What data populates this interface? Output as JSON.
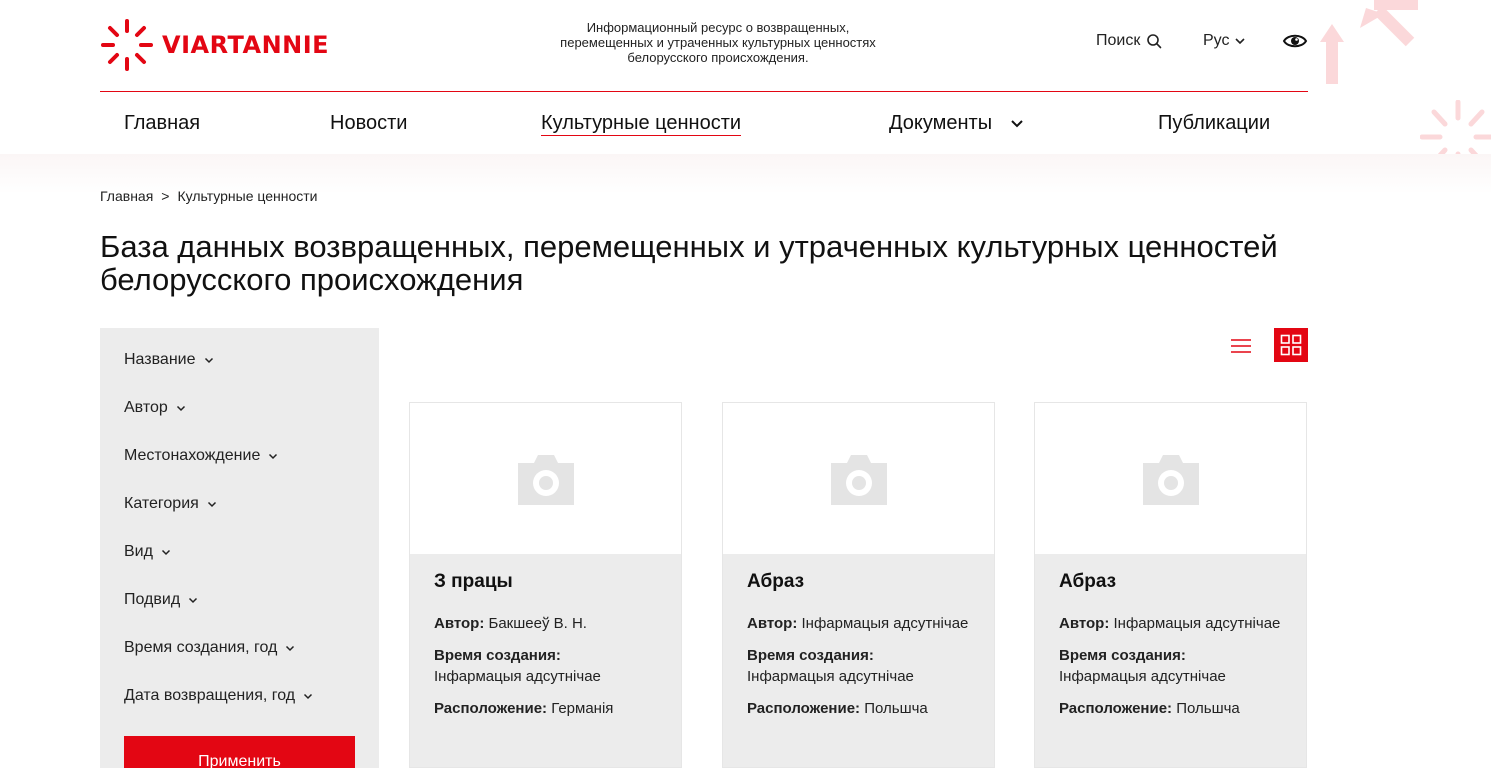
{
  "header": {
    "logo_text": "VIARTANNIE",
    "tagline": "Информационный ресурс о возвращенных, перемещенных и утраченных культурных ценностях белорусского происхождения.",
    "search_label": "Поиск",
    "language": "Рус"
  },
  "nav": {
    "items": [
      {
        "label": "Главная"
      },
      {
        "label": "Новости"
      },
      {
        "label": "Культурные ценности"
      },
      {
        "label": "Документы"
      },
      {
        "label": "Публикации"
      }
    ],
    "active": "Культурные ценности"
  },
  "breadcrumb": {
    "home": "Главная",
    "separator": ">",
    "current": "Культурные ценности"
  },
  "page": {
    "title": "База данных возвращенных, перемещенных и утраченных культурных ценностей белорусского происхождения"
  },
  "filters": {
    "items": [
      {
        "label": "Название"
      },
      {
        "label": "Автор"
      },
      {
        "label": "Местонахождение"
      },
      {
        "label": "Категория"
      },
      {
        "label": "Вид"
      },
      {
        "label": "Подвид"
      },
      {
        "label": "Время создания, год"
      },
      {
        "label": "Дата возвращения, год"
      }
    ],
    "apply_label": "Применить"
  },
  "view": {
    "selected": "grid"
  },
  "cards": [
    {
      "title": "З працы",
      "author_label": "Автор:",
      "author": "Бакшееў В. Н.",
      "created_label": "Время создания:",
      "created": "Інфармацыя адсутнічае",
      "location_label": "Расположение:",
      "location": "Германія"
    },
    {
      "title": "Абраз",
      "author_label": "Автор:",
      "author": "Інфармацыя адсутнічае",
      "created_label": "Время создания:",
      "created": "Інфармацыя адсутнічае",
      "location_label": "Расположение:",
      "location": "Польшча"
    },
    {
      "title": "Абраз",
      "author_label": "Автор:",
      "author": "Інфармацыя адсутнічае",
      "created_label": "Время создания:",
      "created": "Інфармацыя адсутнічае",
      "location_label": "Расположение:",
      "location": "Польшча"
    }
  ],
  "colors": {
    "accent": "#e30613",
    "panel": "#ececec",
    "text": "#111111"
  },
  "icons": [
    "logo-icon",
    "search-icon",
    "chevron-down-icon",
    "eye-icon",
    "list-view-icon",
    "grid-view-icon",
    "camera-placeholder-icon"
  ]
}
